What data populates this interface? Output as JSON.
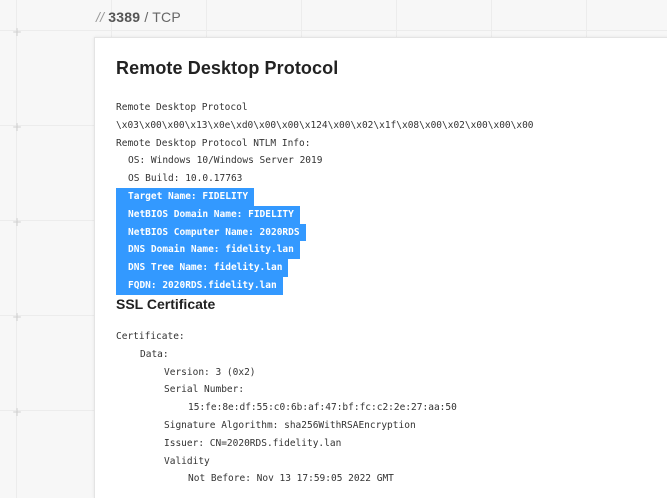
{
  "header": {
    "slashes": "//",
    "port": "3389",
    "sep": "/",
    "protocol": "TCP"
  },
  "section": {
    "title": "Remote Desktop Protocol",
    "banner": [
      {
        "text": "Remote Desktop Protocol",
        "indent": 0,
        "highlight": false
      },
      {
        "text": "\\x03\\x00\\x00\\x13\\x0e\\xd0\\x00\\x00\\x124\\x00\\x02\\x1f\\x08\\x00\\x02\\x00\\x00\\x00",
        "indent": 0,
        "highlight": false
      },
      {
        "text": "Remote Desktop Protocol NTLM Info:",
        "indent": 0,
        "highlight": false
      },
      {
        "text": "OS: Windows 10/Windows Server 2019",
        "indent": 1,
        "highlight": false
      },
      {
        "text": "OS Build: 10.0.17763",
        "indent": 1,
        "highlight": false
      },
      {
        "text": "Target Name: FIDELITY",
        "indent": 1,
        "highlight": true
      },
      {
        "text": "NetBIOS Domain Name: FIDELITY",
        "indent": 1,
        "highlight": true
      },
      {
        "text": "NetBIOS Computer Name: 2020RDS",
        "indent": 1,
        "highlight": true
      },
      {
        "text": "DNS Domain Name: fidelity.lan",
        "indent": 1,
        "highlight": true
      },
      {
        "text": "DNS Tree Name: fidelity.lan",
        "indent": 1,
        "highlight": true
      },
      {
        "text": "FQDN: 2020RDS.fidelity.lan",
        "indent": 1,
        "highlight": true
      }
    ]
  },
  "ssl": {
    "title": "SSL Certificate",
    "lines": [
      {
        "text": "Certificate:",
        "indent": 0
      },
      {
        "text": "Data:",
        "indent": 1
      },
      {
        "text": "Version: 3 (0x2)",
        "indent": 2
      },
      {
        "text": "Serial Number:",
        "indent": 2
      },
      {
        "text": "15:fe:8e:df:55:c0:6b:af:47:bf:fc:c2:2e:27:aa:50",
        "indent": 3
      },
      {
        "text": "Signature Algorithm: sha256WithRSAEncryption",
        "indent": 2
      },
      {
        "text": "Issuer: CN=2020RDS.fidelity.lan",
        "indent": 2
      },
      {
        "text": "Validity",
        "indent": 2
      },
      {
        "text": "Not Before: Nov 13 17:59:05 2022 GMT",
        "indent": 3
      }
    ]
  },
  "colors": {
    "highlight": "#3399ff",
    "text": "#333333"
  }
}
